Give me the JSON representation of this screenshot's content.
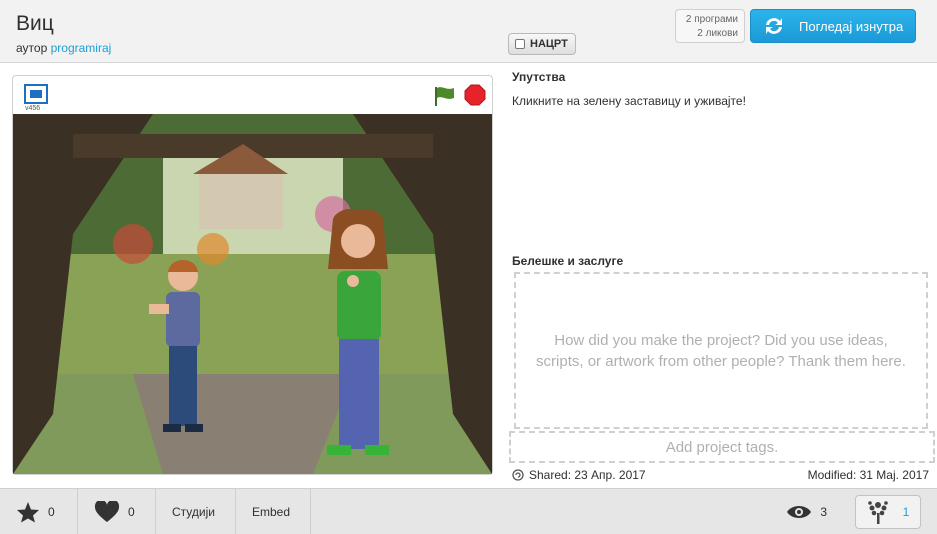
{
  "project": {
    "title": "Виц",
    "byline_prefix": "аутор",
    "author": "programiraj",
    "draft_label": "НАЦРТ",
    "scripts_count": "2 програми",
    "sprites_count": "2 ликови",
    "see_inside_label": "Погледај изнутра"
  },
  "player": {
    "version": "v456",
    "icons": [
      "fullscreen-icon",
      "green-flag-icon",
      "stop-icon"
    ]
  },
  "details": {
    "instructions_label": "Упутства",
    "instructions_text": "Кликните на зелену заставицу и уживајте!",
    "notes_label": "Белешке и заслуге",
    "notes_placeholder": "How did you make the project? Did you use ideas, scripts, or artwork from other people? Thank them here.",
    "tags_placeholder": "Add project tags.",
    "shared": "Shared: 23 Апр. 2017",
    "modified": "Modified: 31 Maj. 2017"
  },
  "footer": {
    "favorites": "0",
    "loves": "0",
    "studios_label": "Студији",
    "embed_label": "Embed",
    "views": "3",
    "remixes": "1"
  },
  "colors": {
    "accent": "#1aa0d8",
    "stop": "#e6232a",
    "flag": "#4d8a29"
  }
}
